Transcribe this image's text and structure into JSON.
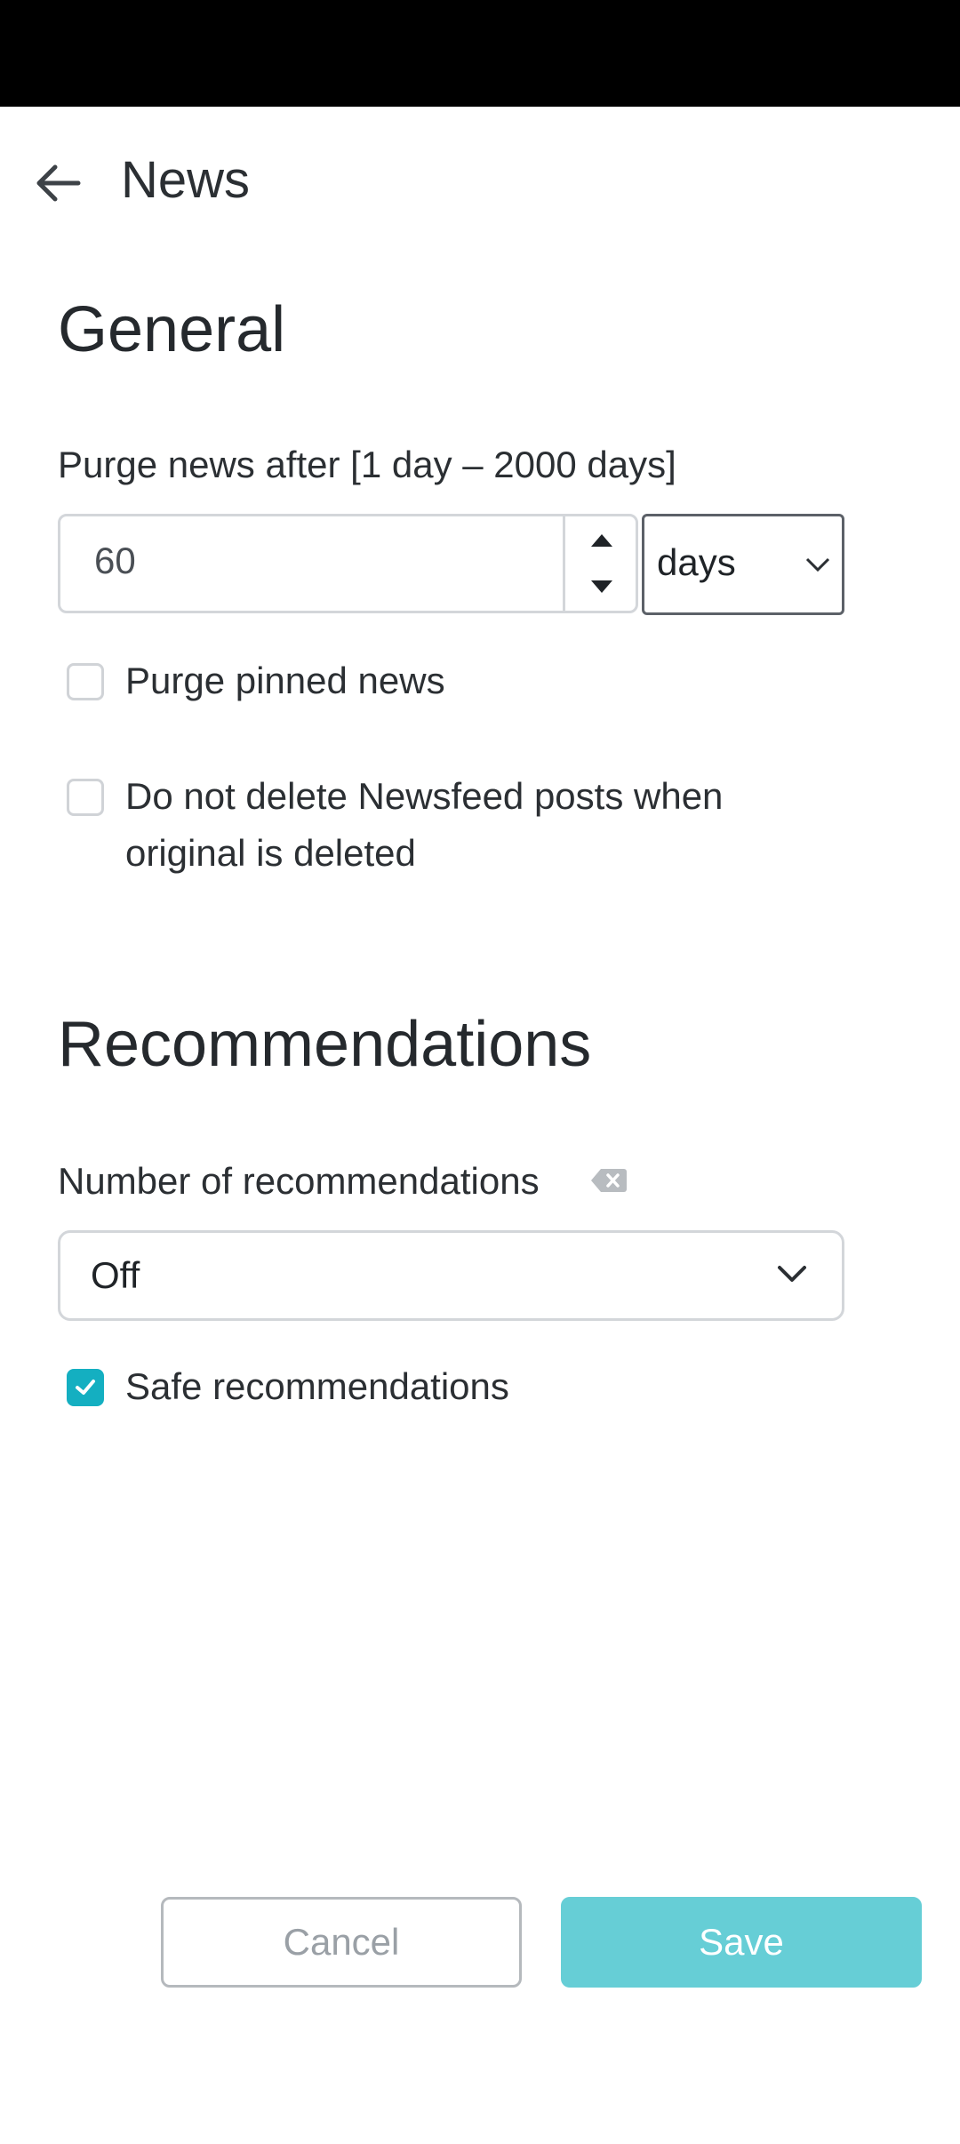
{
  "header": {
    "title": "News",
    "back_icon": "arrow-left-icon"
  },
  "general": {
    "heading": "General",
    "purge_label": "Purge news after [1 day – 2000 days]",
    "purge_value": "60",
    "unit_selected": "days",
    "purge_pinned": {
      "label": "Purge pinned news",
      "checked": false
    },
    "keep_newsfeed": {
      "label_line1": "Do not delete Newsfeed posts when",
      "label_line2": "original is deleted",
      "checked": false
    }
  },
  "recommendations": {
    "heading": "Recommendations",
    "number_label": "Number of recommendations",
    "number_selected": "Off",
    "safe": {
      "label": "Safe recommendations",
      "checked": true
    }
  },
  "actions": {
    "cancel_label": "Cancel",
    "save_label": "Save"
  },
  "colors": {
    "accent": "#14afc1",
    "save_bg": "#66ced6",
    "status_bar": "#000000"
  }
}
